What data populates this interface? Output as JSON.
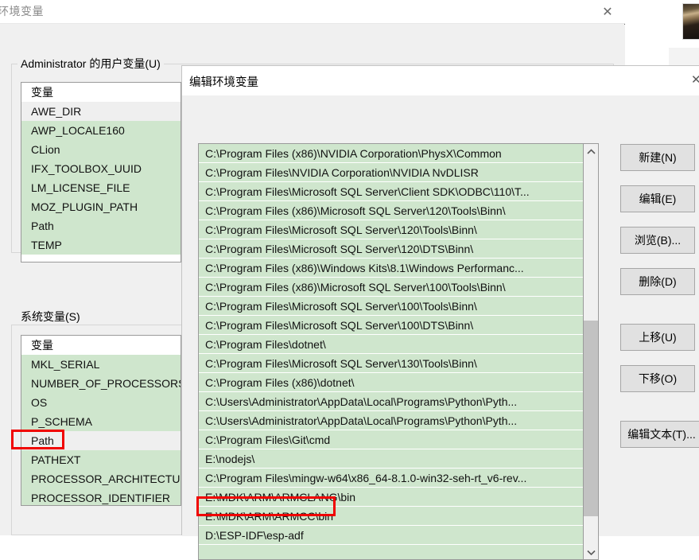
{
  "main_window": {
    "title": "环境变量",
    "close_label": "✕",
    "user_group_label": "Administrator 的用户变量(U)",
    "system_group_label": "系统变量(S)",
    "column_header": "变量",
    "user_variables": [
      "AWE_DIR",
      "AWP_LOCALE160",
      "CLion",
      "IFX_TOOLBOX_UUID",
      "LM_LICENSE_FILE",
      "MOZ_PLUGIN_PATH",
      "Path",
      "TEMP"
    ],
    "system_variables": [
      "MKL_SERIAL",
      "NUMBER_OF_PROCESSORS",
      "OS",
      "P_SCHEMA",
      "Path",
      "PATHEXT",
      "PROCESSOR_ARCHITECTURE",
      "PROCESSOR_IDENTIFIER"
    ],
    "highlighted_system_variable": "Path"
  },
  "edit_dialog": {
    "title": "编辑环境变量",
    "close_label": "✕",
    "path_entries": [
      "C:\\Program Files (x86)\\NVIDIA Corporation\\PhysX\\Common",
      "C:\\Program Files\\NVIDIA Corporation\\NVIDIA NvDLISR",
      "C:\\Program Files\\Microsoft SQL Server\\Client SDK\\ODBC\\110\\T...",
      "C:\\Program Files (x86)\\Microsoft SQL Server\\120\\Tools\\Binn\\",
      "C:\\Program Files\\Microsoft SQL Server\\120\\Tools\\Binn\\",
      "C:\\Program Files\\Microsoft SQL Server\\120\\DTS\\Binn\\",
      "C:\\Program Files (x86)\\Windows Kits\\8.1\\Windows Performanc...",
      "C:\\Program Files (x86)\\Microsoft SQL Server\\100\\Tools\\Binn\\",
      "C:\\Program Files\\Microsoft SQL Server\\100\\Tools\\Binn\\",
      "C:\\Program Files\\Microsoft SQL Server\\100\\DTS\\Binn\\",
      "C:\\Program Files\\dotnet\\",
      "C:\\Program Files\\Microsoft SQL Server\\130\\Tools\\Binn\\",
      "C:\\Program Files (x86)\\dotnet\\",
      "C:\\Users\\Administrator\\AppData\\Local\\Programs\\Python\\Pyth...",
      "C:\\Users\\Administrator\\AppData\\Local\\Programs\\Python\\Pyth...",
      "C:\\Program Files\\Git\\cmd",
      "E:\\nodejs\\",
      "C:\\Program Files\\mingw-w64\\x86_64-8.1.0-win32-seh-rt_v6-rev...",
      "E:\\MDK\\ARM\\ARMCLANG\\bin",
      "E:\\MDK\\ARM\\ARMCC\\bin",
      "D:\\ESP-IDF\\esp-adf",
      ""
    ],
    "highlighted_path_entry": "D:\\ESP-IDF\\esp-adf",
    "buttons": [
      {
        "label": "新建(N)",
        "name": "new-button"
      },
      {
        "label": "编辑(E)",
        "name": "edit-button"
      },
      {
        "label": "浏览(B)...",
        "name": "browse-button"
      },
      {
        "label": "删除(D)",
        "name": "delete-button"
      },
      {
        "label": "上移(U)",
        "name": "move-up-button"
      },
      {
        "label": "下移(O)",
        "name": "move-down-button"
      },
      {
        "label": "编辑文本(T)...",
        "name": "edit-text-button"
      }
    ],
    "scrollbar": {
      "up_arrow": "⌃",
      "down_arrow": "⌄"
    }
  },
  "colors": {
    "list_background": "#cfe6cd",
    "selection": "#efefef",
    "annotation": "#f00200",
    "dialog_background": "#f0f0f0"
  }
}
